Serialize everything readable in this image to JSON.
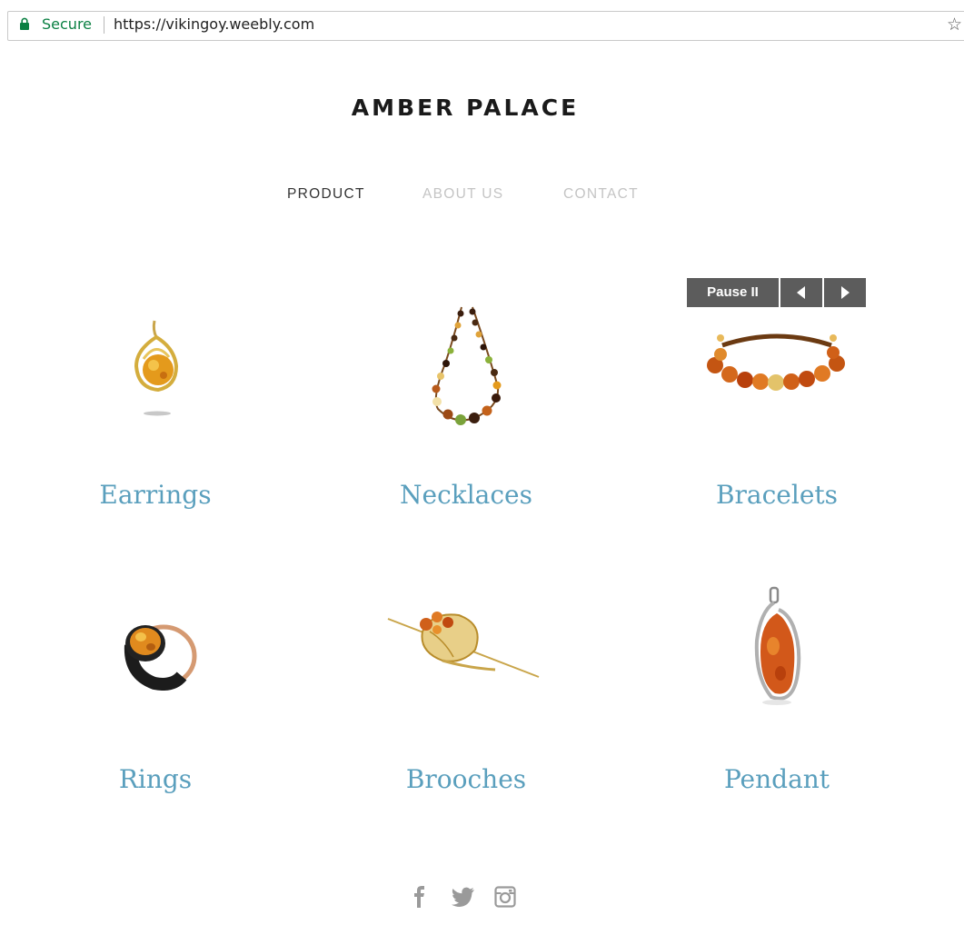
{
  "browser": {
    "secure_label": "Secure",
    "url": "https://vikingoy.weebly.com",
    "secure_color": "#0b8043"
  },
  "site": {
    "title": "AMBER PALACE"
  },
  "nav": {
    "items": [
      {
        "label": "PRODUCT",
        "active": true
      },
      {
        "label": "ABOUT US",
        "active": false
      },
      {
        "label": "CONTACT",
        "active": false
      }
    ]
  },
  "slideshow": {
    "pause_label": "Pause II"
  },
  "products": [
    {
      "label": "Earrings"
    },
    {
      "label": "Necklaces"
    },
    {
      "label": "Bracelets"
    },
    {
      "label": "Rings"
    },
    {
      "label": "Brooches"
    },
    {
      "label": "Pendant"
    }
  ],
  "colors": {
    "accent": "#5a9fbd",
    "amber": "#d9772a",
    "gold": "#d8b04a"
  },
  "social": [
    "facebook-icon",
    "twitter-icon",
    "instagram-icon"
  ]
}
